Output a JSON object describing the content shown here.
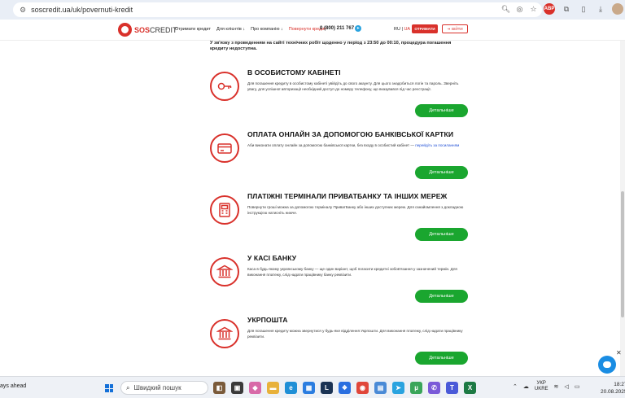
{
  "browser": {
    "url": "soscredit.ua/uk/povernuti-kredit"
  },
  "header": {
    "logo_sos": "SOS",
    "logo_credit": "CREDIT",
    "nav": [
      "Отримати кредит",
      "Для клієнтів ↓",
      "Про компанію ↓",
      "Повернути кредит"
    ],
    "phone": "0 (800) 211 767",
    "lang_ru": "RU",
    "lang_sep": " | ",
    "lang_ua": "UA",
    "get_button": "ОТРИМАТИ",
    "login_button": "ВІЙТИ"
  },
  "notice": "У зв'язку з проведенням на сайті технічних робіт щоденно у період з 23:50 до 00:10, процедура погашення кредиту недоступна.",
  "sections": [
    {
      "title": "В ОСОБИСТОМУ КАБІНЕТІ",
      "desc": "Для погашення кредиту в особистому кабінеті увійдіть до свого акаунту. Для цього знадобиться логін та пароль. Зверніть увагу, для успішної авторизації необхідний доступ до номеру телефону, що вказувався під час реєстрації.",
      "link": "",
      "button": "Детальніше",
      "icon": "key-icon"
    },
    {
      "title": "ОПЛАТА ОНЛАЙН ЗА ДОПОМОГОЮ БАНКІВСЬКОЇ КАРТКИ",
      "desc": "Аби виконати оплату онлайн за допомогою банківської картки, без входу в особистий кабінет — ",
      "link": "перейдіть за посиланням",
      "button": "Детальніше",
      "icon": "card-icon"
    },
    {
      "title": "ПЛАТІЖНІ ТЕРМІНАЛИ ПРИВАТБАНКУ ТА ІНШИХ МЕРЕЖ",
      "desc": "Повернути гроші можна за допомогою терміналу ПриватБанку або інших доступних мереж. Для ознайомлення з докладною інструкцією натисніть нижче.",
      "link": "",
      "button": "Детальніше",
      "icon": "terminal-icon"
    },
    {
      "title": "У КАСІ БАНКУ",
      "desc": "Каса в будь-якому українському банку — ще один варіант, щоб погасити кредитні зобов'язання у зазначений термін. Для виконання платежу, слід надати працівнику банку реквізити.",
      "link": "",
      "button": "Детальніше",
      "icon": "bank-icon"
    },
    {
      "title": "УКРПОШТА",
      "desc": "Для погашення кредиту можна звернутися у будь-яке відділення Укрпошти. Для виконання платежу, слід надати працівнику реквізити.",
      "link": "",
      "button": "Детальніше",
      "icon": "bank-icon"
    }
  ],
  "taskbar": {
    "left_text": "ays ahead",
    "search_placeholder": "Швидкий пошук",
    "lang_line1": "УКР",
    "lang_line2": "UKRE",
    "time": "18:27",
    "date": "20.08.2025"
  },
  "colors": {
    "brand_red": "#d9312b",
    "button_green": "#1aa62f",
    "link_blue": "#1f4fd6",
    "chat_blue": "#1a8de3"
  }
}
